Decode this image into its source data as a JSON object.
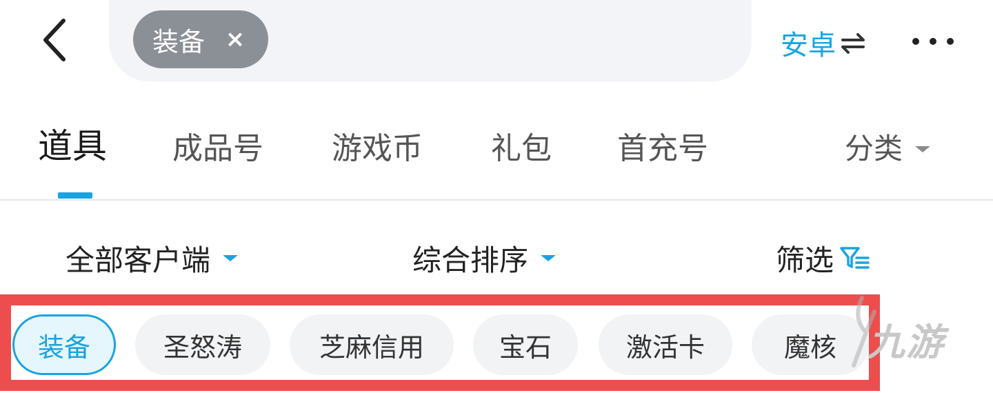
{
  "header": {
    "search_tag": "装备",
    "search_tag_close": "×",
    "platform_label": "安卓"
  },
  "tabs": [
    {
      "label": "道具",
      "active": true
    },
    {
      "label": "成品号",
      "active": false
    },
    {
      "label": "游戏币",
      "active": false
    },
    {
      "label": "礼包",
      "active": false
    },
    {
      "label": "首充号",
      "active": false
    }
  ],
  "category_label": "分类",
  "filters": {
    "client": "全部客户端",
    "sort": "综合排序",
    "screen": "筛选"
  },
  "tags": [
    {
      "label": "装备",
      "selected": true
    },
    {
      "label": "圣怒涛",
      "selected": false
    },
    {
      "label": "芝麻信用",
      "selected": false
    },
    {
      "label": "宝石",
      "selected": false
    },
    {
      "label": "激活卡",
      "selected": false
    },
    {
      "label": "魔核",
      "selected": false
    }
  ],
  "watermark": "九游",
  "colors": {
    "accent": "#1aa3e0",
    "highlight_border": "#ee4d4d",
    "chip_bg": "#8b8f96"
  }
}
